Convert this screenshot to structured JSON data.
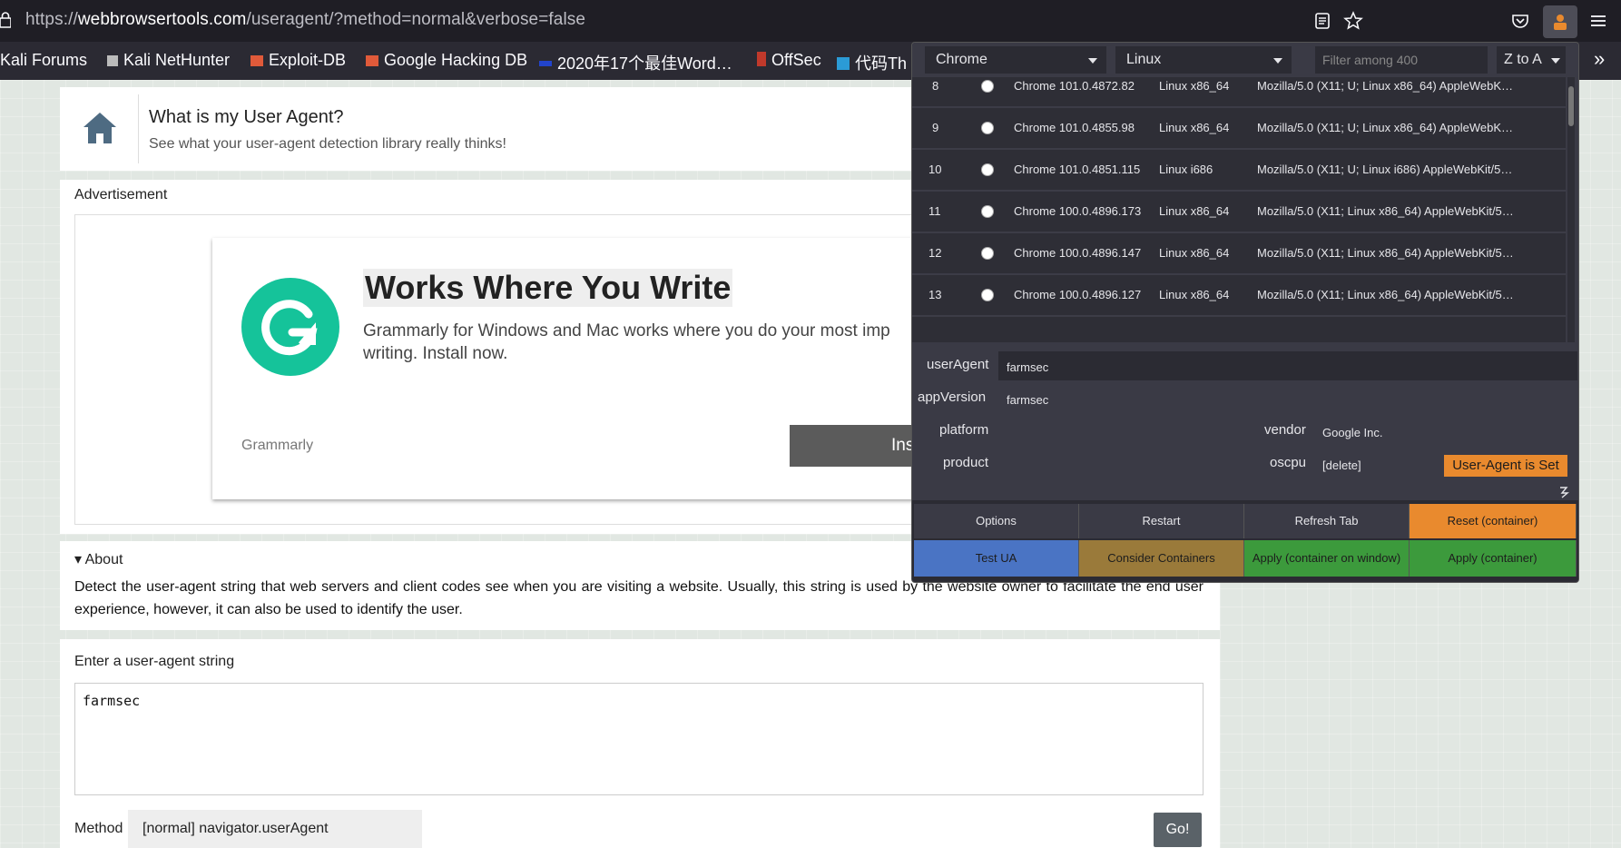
{
  "browser": {
    "url_prefix": "https://",
    "url_host": "webbrowsertools.com",
    "url_rest": "/useragent/?method=normal&verbose=false"
  },
  "bookmarks": [
    {
      "label": "Kali Forums",
      "color": "#4a9dd6"
    },
    {
      "label": "Kali NetHunter",
      "color": "#cccccc"
    },
    {
      "label": "Exploit-DB",
      "color": "#e05a3a"
    },
    {
      "label": "Google Hacking DB",
      "color": "#e05a3a"
    },
    {
      "label": "2020年17个最佳Word…",
      "color": "#2244cc"
    },
    {
      "label": "OffSec",
      "color": "#c0392b"
    },
    {
      "label": "代码Th",
      "color": "#2b9bd6"
    }
  ],
  "page": {
    "title": "What is my User Agent?",
    "subtitle": "See what your user-agent detection library really thinks!",
    "ad_label": "Advertisement",
    "ad_heading": "Works Where You Write",
    "ad_text": "Grammarly for Windows and Mac works where you do your most imp writing. Install now.",
    "ad_brand": "Grammarly",
    "ad_button": "Ins",
    "about_title": "▾ About",
    "about_text": "Detect the user-agent string that web servers and client codes see when you are visiting a website. Usually, this string is used by the website owner to facilitate the end user experience, however, it can also be used to identify the user.",
    "enter_label": "Enter a user-agent string",
    "ua_value": "farmsec",
    "method_label": "Method",
    "method_value": "[normal] navigator.userAgent",
    "go_label": "Go!"
  },
  "popup": {
    "browser_select": "Chrome",
    "os_select": "Linux",
    "filter_placeholder": "Filter among 400",
    "sort_select": "Z to A",
    "rows": [
      {
        "num": "8",
        "browser": "Chrome 101.0.4872.82",
        "os": "Linux x86_64",
        "ua": "Mozilla/5.0 (X11; U; Linux x86_64) AppleWebK…"
      },
      {
        "num": "9",
        "browser": "Chrome 101.0.4855.98",
        "os": "Linux x86_64",
        "ua": "Mozilla/5.0 (X11; U; Linux x86_64) AppleWebK…"
      },
      {
        "num": "10",
        "browser": "Chrome 101.0.4851.115",
        "os": "Linux i686",
        "ua": "Mozilla/5.0 (X11; U; Linux i686) AppleWebKit/5…"
      },
      {
        "num": "11",
        "browser": "Chrome 100.0.4896.173",
        "os": "Linux x86_64",
        "ua": "Mozilla/5.0 (X11; Linux x86_64) AppleWebKit/5…"
      },
      {
        "num": "12",
        "browser": "Chrome 100.0.4896.147",
        "os": "Linux x86_64",
        "ua": "Mozilla/5.0 (X11; Linux x86_64) AppleWebKit/5…"
      },
      {
        "num": "13",
        "browser": "Chrome 100.0.4896.127",
        "os": "Linux x86_64",
        "ua": "Mozilla/5.0 (X11; Linux x86_64) AppleWebKit/5…"
      }
    ],
    "fields": {
      "useragent_label": "userAgent",
      "useragent_value": "farmsec",
      "appversion_label": "appVersion",
      "appversion_value": "farmsec",
      "platform_label": "platform",
      "vendor_label": "vendor",
      "vendor_value": "Google Inc.",
      "product_label": "product",
      "oscpu_label": "oscpu",
      "oscpu_value": "[delete]"
    },
    "ua_set_badge": "User-Agent is Set",
    "buttons_row1": [
      {
        "label": "Options",
        "bg": "#3a3a45"
      },
      {
        "label": "Restart",
        "bg": "#3a3a45"
      },
      {
        "label": "Refresh Tab",
        "bg": "#3a3a45"
      },
      {
        "label": "Reset (container)",
        "bg": "#e98a2e"
      }
    ],
    "buttons_row2": [
      {
        "label": "Test UA",
        "bg": "#4a74c4"
      },
      {
        "label": "Consider Containers",
        "bg": "#9a7a3a"
      },
      {
        "label": "Apply (container on window)",
        "bg": "#3c9a3c"
      },
      {
        "label": "Apply (container)",
        "bg": "#3c9a3c"
      }
    ]
  }
}
